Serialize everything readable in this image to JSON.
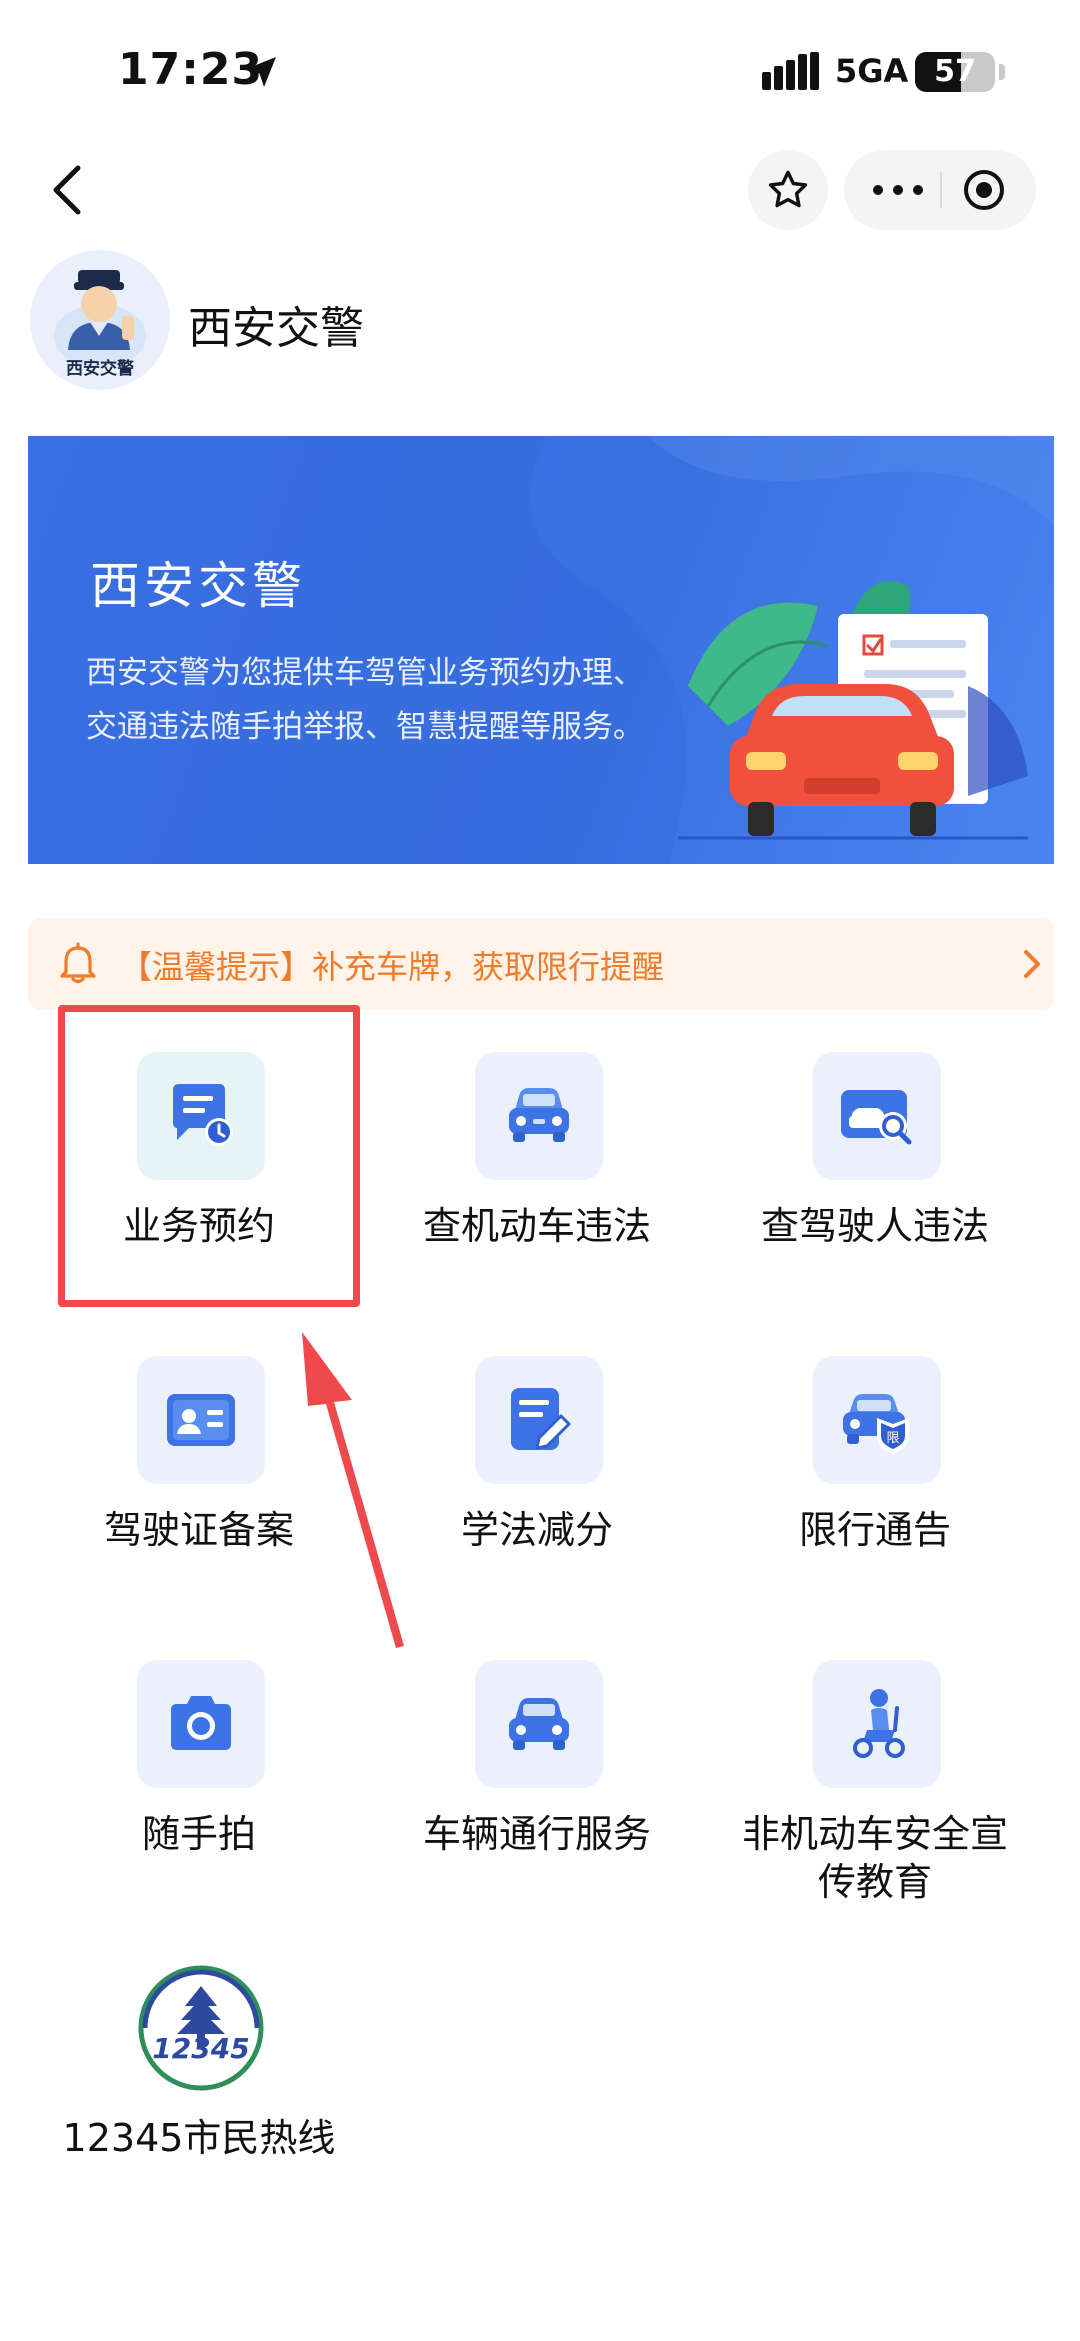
{
  "status_bar": {
    "time": "17:23",
    "network": "5GA",
    "battery_level": "57",
    "battery_fraction": 0.57
  },
  "nav": {
    "back_icon": "chevron-left-icon",
    "star_icon": "star-outline-icon",
    "more_icon": "more-dots-icon",
    "close_icon": "target-circle-icon"
  },
  "app": {
    "name": "西安交警",
    "logo_text": "西安交警"
  },
  "banner": {
    "title": "西安交警",
    "description": "西安交警为您提供车驾管业务预约办理、交通违法随手拍举报、智慧提醒等服务。"
  },
  "notice": {
    "text": "【温馨提示】补充车牌，获取限行提醒"
  },
  "services": [
    {
      "label": "业务预约",
      "icon": "appointment-chat-clock-icon"
    },
    {
      "label": "查机动车违法",
      "icon": "car-front-icon"
    },
    {
      "label": "查驾驶人违法",
      "icon": "driver-search-icon"
    },
    {
      "label": "驾驶证备案",
      "icon": "license-card-icon"
    },
    {
      "label": "学法减分",
      "icon": "study-edit-icon"
    },
    {
      "label": "限行通告",
      "icon": "car-restriction-icon"
    },
    {
      "label": "随手拍",
      "icon": "camera-icon"
    },
    {
      "label": "车辆通行服务",
      "icon": "car-pass-icon"
    },
    {
      "label": "非机动车安全宣传教育",
      "icon": "scooter-rider-icon"
    },
    {
      "label": "12345市民热线",
      "icon": "hotline-12345-logo"
    }
  ],
  "colors": {
    "accent_blue": "#3d73e4",
    "notice_orange": "#f07b2a",
    "highlight_red": "#ee4a4c"
  }
}
